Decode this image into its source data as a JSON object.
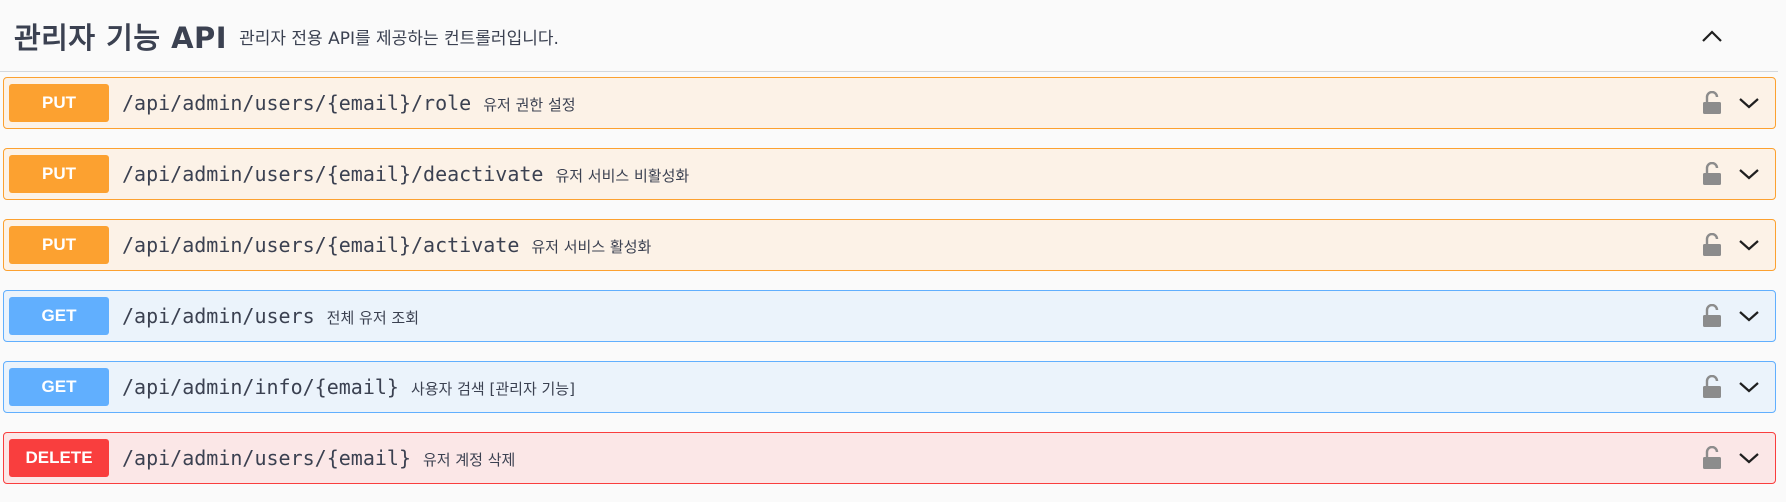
{
  "tag": {
    "title": "관리자 기능 API",
    "description": "관리자 전용 API를 제공하는 컨트롤러입니다."
  },
  "operations": [
    {
      "method": "PUT",
      "path": "/api/admin/users/{email}/role",
      "summary": "유저 권한 설정"
    },
    {
      "method": "PUT",
      "path": "/api/admin/users/{email}/deactivate",
      "summary": "유저 서비스 비활성화"
    },
    {
      "method": "PUT",
      "path": "/api/admin/users/{email}/activate",
      "summary": "유저 서비스 활성화"
    },
    {
      "method": "GET",
      "path": "/api/admin/users",
      "summary": "전체 유저 조회"
    },
    {
      "method": "GET",
      "path": "/api/admin/info/{email}",
      "summary": "사용자 검색 [관리자 기능]"
    },
    {
      "method": "DELETE",
      "path": "/api/admin/users/{email}",
      "summary": "유저 계정 삭제"
    }
  ],
  "colors": {
    "put": "#fca130",
    "get": "#61affe",
    "delete": "#f93e3e",
    "text": "#3b4151"
  },
  "icons": {
    "collapse": "chevron-up-icon",
    "expand": "chevron-down-icon",
    "auth": "unlocked-padlock-icon"
  }
}
